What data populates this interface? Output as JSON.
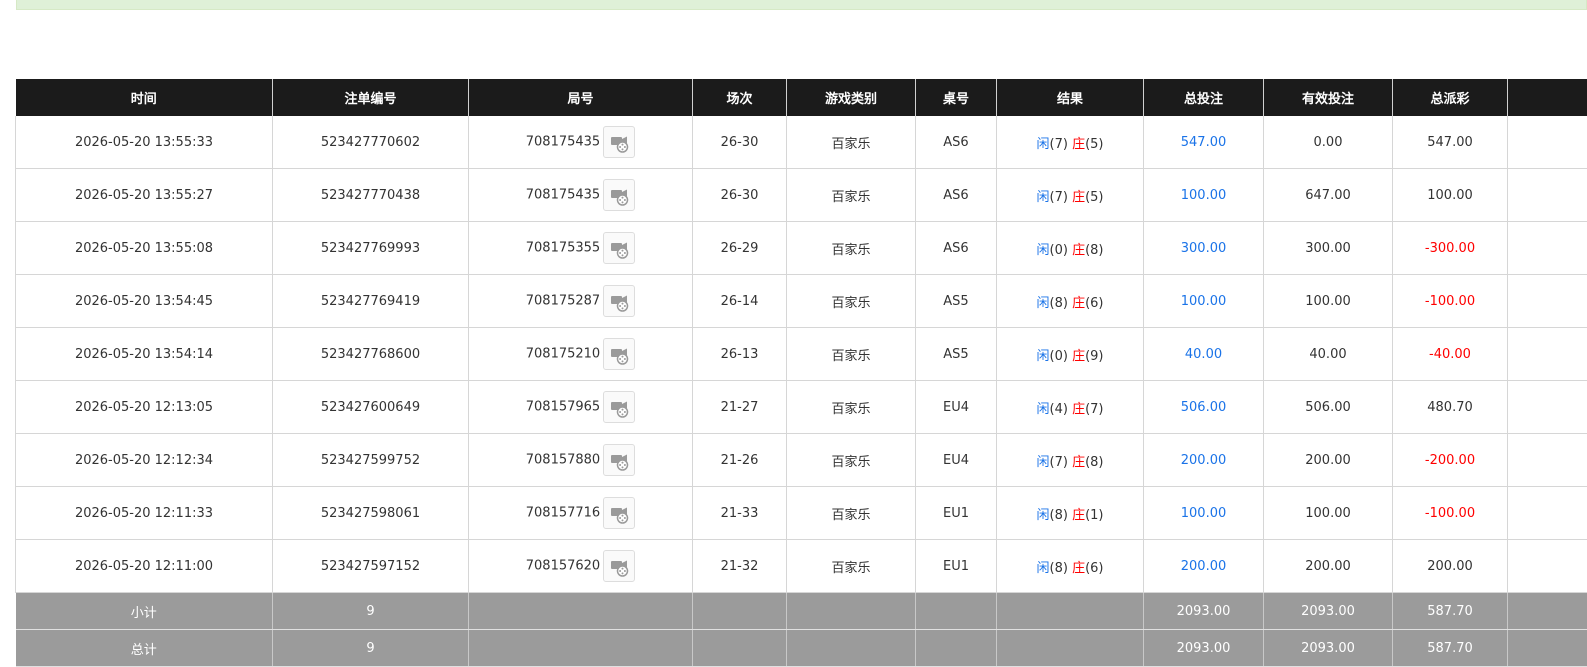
{
  "headers": [
    "时间",
    "注单编号",
    "局号",
    "场次",
    "游戏类别",
    "桌号",
    "结果",
    "总投注",
    "有效投注",
    "总派彩",
    ""
  ],
  "rows": [
    {
      "time": "2026-05-20 13:55:33",
      "bet_id": "523427770602",
      "round": "708175435",
      "session": "26-30",
      "game": "百家乐",
      "table": "AS6",
      "player_label": "闲",
      "player_value": "(7)",
      "banker_label": "庄",
      "banker_value": "(5)",
      "total_bet": "547.00",
      "valid_bet": "0.00",
      "payout": "547.00",
      "payout_negative": false
    },
    {
      "time": "2026-05-20 13:55:27",
      "bet_id": "523427770438",
      "round": "708175435",
      "session": "26-30",
      "game": "百家乐",
      "table": "AS6",
      "player_label": "闲",
      "player_value": "(7)",
      "banker_label": "庄",
      "banker_value": "(5)",
      "total_bet": "100.00",
      "valid_bet": "647.00",
      "payout": "100.00",
      "payout_negative": false
    },
    {
      "time": "2026-05-20 13:55:08",
      "bet_id": "523427769993",
      "round": "708175355",
      "session": "26-29",
      "game": "百家乐",
      "table": "AS6",
      "player_label": "闲",
      "player_value": "(0)",
      "banker_label": "庄",
      "banker_value": "(8)",
      "total_bet": "300.00",
      "valid_bet": "300.00",
      "payout": "-300.00",
      "payout_negative": true
    },
    {
      "time": "2026-05-20 13:54:45",
      "bet_id": "523427769419",
      "round": "708175287",
      "session": "26-14",
      "game": "百家乐",
      "table": "AS5",
      "player_label": "闲",
      "player_value": "(8)",
      "banker_label": "庄",
      "banker_value": "(6)",
      "total_bet": "100.00",
      "valid_bet": "100.00",
      "payout": "-100.00",
      "payout_negative": true
    },
    {
      "time": "2026-05-20 13:54:14",
      "bet_id": "523427768600",
      "round": "708175210",
      "session": "26-13",
      "game": "百家乐",
      "table": "AS5",
      "player_label": "闲",
      "player_value": "(0)",
      "banker_label": "庄",
      "banker_value": "(9)",
      "total_bet": "40.00",
      "valid_bet": "40.00",
      "payout": "-40.00",
      "payout_negative": true
    },
    {
      "time": "2026-05-20 12:13:05",
      "bet_id": "523427600649",
      "round": "708157965",
      "session": "21-27",
      "game": "百家乐",
      "table": "EU4",
      "player_label": "闲",
      "player_value": "(4)",
      "banker_label": "庄",
      "banker_value": "(7)",
      "total_bet": "506.00",
      "valid_bet": "506.00",
      "payout": "480.70",
      "payout_negative": false
    },
    {
      "time": "2026-05-20 12:12:34",
      "bet_id": "523427599752",
      "round": "708157880",
      "session": "21-26",
      "game": "百家乐",
      "table": "EU4",
      "player_label": "闲",
      "player_value": "(7)",
      "banker_label": "庄",
      "banker_value": "(8)",
      "total_bet": "200.00",
      "valid_bet": "200.00",
      "payout": "-200.00",
      "payout_negative": true
    },
    {
      "time": "2026-05-20 12:11:33",
      "bet_id": "523427598061",
      "round": "708157716",
      "session": "21-33",
      "game": "百家乐",
      "table": "EU1",
      "player_label": "闲",
      "player_value": "(8)",
      "banker_label": "庄",
      "banker_value": "(1)",
      "total_bet": "100.00",
      "valid_bet": "100.00",
      "payout": "-100.00",
      "payout_negative": true
    },
    {
      "time": "2026-05-20 12:11:00",
      "bet_id": "523427597152",
      "round": "708157620",
      "session": "21-32",
      "game": "百家乐",
      "table": "EU1",
      "player_label": "闲",
      "player_value": "(8)",
      "banker_label": "庄",
      "banker_value": "(6)",
      "total_bet": "200.00",
      "valid_bet": "200.00",
      "payout": "200.00",
      "payout_negative": false
    }
  ],
  "subtotal": {
    "label": "小计",
    "count": "9",
    "total_bet": "2093.00",
    "valid_bet": "2093.00",
    "payout": "587.70"
  },
  "total": {
    "label": "总计",
    "count": "9",
    "total_bet": "2093.00",
    "valid_bet": "2093.00",
    "payout": "587.70"
  },
  "colors": {
    "header_bg": "#1b1b1b",
    "summary_bg": "#9b9b9b",
    "link_blue": "#1a73e8",
    "loss_red": "#ff0000",
    "top_bar_bg": "#dff0d8"
  },
  "icons": {
    "replay": "video-camera-icon"
  }
}
